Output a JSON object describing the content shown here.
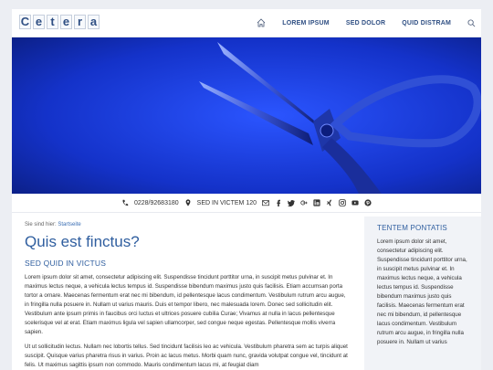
{
  "header": {
    "logo_letters": [
      "C",
      "e",
      "t",
      "e",
      "r",
      "a"
    ],
    "nav": [
      "LOREM IPSUM",
      "SED DOLOR",
      "QUID DISTRAM"
    ]
  },
  "hero": {
    "image": "blue-scissors-photo"
  },
  "contact": {
    "phone": "0228/92683180",
    "location": "SED IN VICTEM 120",
    "icons": [
      "mail-icon",
      "facebook-icon",
      "twitter-icon",
      "google-plus-icon",
      "linkedin-icon",
      "xing-icon",
      "instagram-icon",
      "youtube-icon",
      "pinterest-icon"
    ]
  },
  "main": {
    "breadcrumb_prefix": "Sie sind hier:",
    "breadcrumb_link": "Startseite",
    "title": "Quis est finctus?",
    "subtitle": "SED QUID IN VICTUS",
    "para1": "Lorem ipsum dolor sit amet, consectetur adipiscing elit. Suspendisse tincidunt porttitor urna, in suscipit metus pulvinar et. In maximus lectus neque, a vehicula lectus tempus id. Suspendisse bibendum maximus justo quis facilisis. Etiam accumsan porta tortor a ornare. Maecenas fermentum erat nec mi bibendum, id pellentesque lacus condimentum. Vestibulum rutrum arcu augue, in fringilla nulla posuere in. Nullam ut varius mauris. Duis et tempor libero, nec malesuada lorem. Donec sed sollicitudin elit. Vestibulum ante ipsum primis in faucibus orci luctus et ultrices posuere cubilia Curae; Vivamus at nulla in lacus pellentesque scelerisque vel at erat. Etiam maximus ligula vel sapien ullamcorper, sed congue neque egestas. Pellentesque mollis viverra sapien.",
    "para2": "Ut ut sollicitudin lectus. Nullam nec lobortis tellus. Sed tincidunt facilisis leo ac vehicula. Vestibulum pharetra sem ac turpis aliquet suscipit. Quisque varius pharetra risus in varius. Proin ac lacus metus. Morbi quam nunc, gravida volutpat congue vel, tincidunt at felis. Ut maximus sagittis ipsum non commodo. Mauris condimentum lacus mi, at feugiat diam"
  },
  "sidebar": {
    "title": "TENTEM PONTATIS",
    "text": "Lorem ipsum dolor sit amet, consectetur adipiscing elit. Suspendisse tincidunt porttitor urna, in suscipit metus pulvinar et. In maximus lectus neque, a vehicula lectus tempus id. Suspendisse bibendum maximus justo quis facilisis. Maecenas fermentum erat nec mi bibendum, id pellentesque lacus condimentum. Vestibulum rutrum arcu augue, in fringilla nulla posuere in. Nullam ut varius"
  },
  "colors": {
    "accent": "#2f5e9f",
    "link": "#3b6fb4",
    "hero_blue": "#1c3fd6"
  }
}
